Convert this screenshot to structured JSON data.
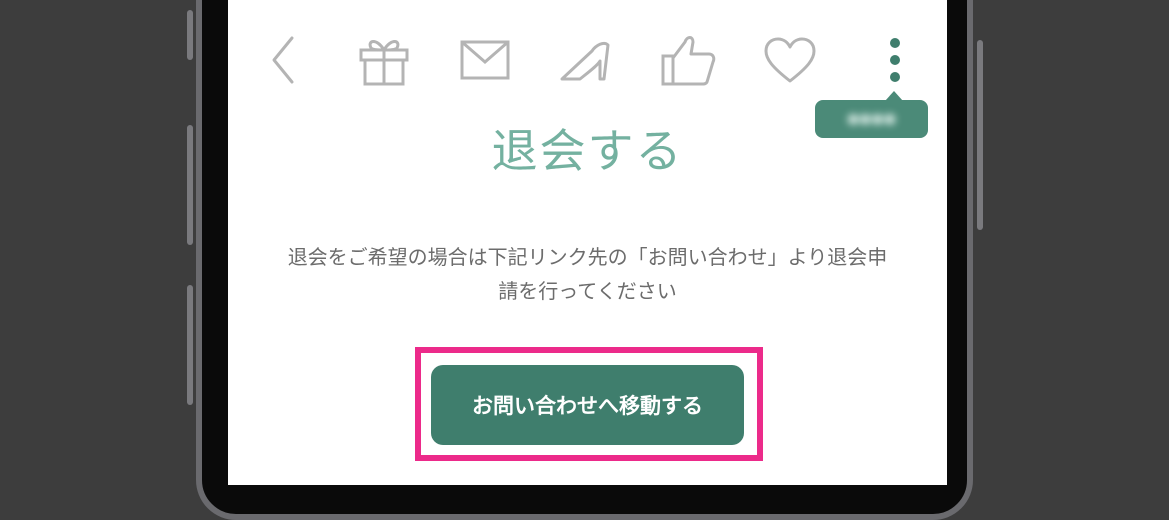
{
  "toolbar": {
    "icons": [
      "back-chevron-icon",
      "gift-icon",
      "mail-icon",
      "high-heel-icon",
      "thumbs-up-icon",
      "heart-icon",
      "more-vertical-icon"
    ],
    "more_menu_tooltip": "●●●●"
  },
  "page": {
    "title": "退会する",
    "description_line1": "退会をご希望の場合は下記リンク先の「お問い合わせ」より退会申",
    "description_line2": "請を行ってください",
    "cta_label": "お問い合わせへ移動する"
  },
  "colors": {
    "accent": "#74b1a0",
    "button": "#3f7e6d",
    "highlight_border": "#ec2a8a",
    "icon_gray": "#b4b4b4"
  }
}
